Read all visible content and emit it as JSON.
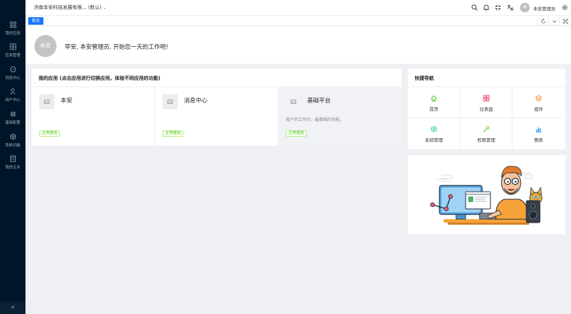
{
  "sidebar": {
    "items": [
      {
        "label": "我的应用",
        "icon": "grid-icon"
      },
      {
        "label": "应用管理",
        "icon": "apps-icon"
      },
      {
        "label": "消息中心",
        "icon": "message-icon"
      },
      {
        "label": "用户中心",
        "icon": "user-icon"
      },
      {
        "label": "基础配置",
        "icon": "hash-icon"
      },
      {
        "label": "系统功能",
        "icon": "gear-icon"
      },
      {
        "label": "我的企业",
        "icon": "building-icon"
      }
    ],
    "collapse_label": "«"
  },
  "header": {
    "tenant": "济南本安科技发展有限... (默认)",
    "avatar_text": "本",
    "username": "本安管理员"
  },
  "tabs": [
    {
      "label": "首页",
      "active": true
    }
  ],
  "welcome": {
    "avatar_text": "本安",
    "greeting": "早安, 本安管理员, 开始您一天的工作吧!"
  },
  "my_apps": {
    "title": "我的应用 (点击应用进行切换应用，体验不同应用的功能)",
    "apps": [
      {
        "name": "本安",
        "desc": "",
        "badge": "正常使用"
      },
      {
        "name": "消息中心",
        "desc": "",
        "badge": "正常使用"
      },
      {
        "name": "基础平台",
        "desc": "租户的工作台，最基础的功能。",
        "badge": "正常使用"
      }
    ]
  },
  "quick_nav": {
    "title": "快捷导航",
    "items": [
      {
        "label": "首页",
        "icon": "home-icon",
        "color": "#52c41a"
      },
      {
        "label": "仪表盘",
        "icon": "dashboard-icon",
        "color": "#eb2f5c"
      },
      {
        "label": "组件",
        "icon": "layers-icon",
        "color": "#fa8c16"
      },
      {
        "label": "系统管理",
        "icon": "settings-icon",
        "color": "#13c2a2"
      },
      {
        "label": "权限管理",
        "icon": "key-icon",
        "color": "#52c41a"
      },
      {
        "label": "图表",
        "icon": "bar-chart-icon",
        "color": "#1890ff"
      }
    ]
  },
  "colors": {
    "sidebar_bg": "#001529",
    "primary": "#1677ff",
    "success": "#52c41a"
  }
}
